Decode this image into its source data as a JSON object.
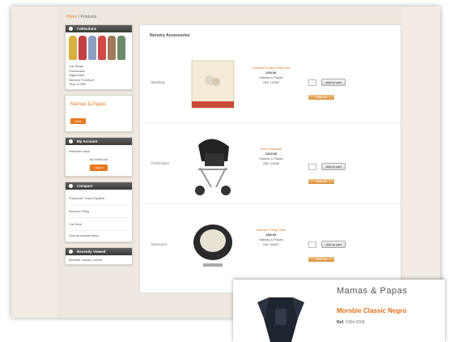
{
  "breadcrumb": {
    "home": "Home",
    "current": "Products"
  },
  "sidebar": {
    "collections": {
      "title": "Collections",
      "links": [
        "Car Seats",
        "Pushchairs",
        "Highchairs",
        "Nursery Furniture",
        "Toys & Gifts"
      ]
    },
    "promo": {
      "title": "Mamas & Papas",
      "button": "View"
    },
    "account": {
      "title": "My Account",
      "label": "Welcome back",
      "value": "My Wish List",
      "button": "Log In"
    },
    "compare": {
      "title": "Compare",
      "items": [
        "Pushchair Travel System",
        "Bouncer Sling",
        "Car Seat"
      ],
      "footer": "Clear all compare items"
    },
    "recent": {
      "title": "Recently Viewed",
      "items": [
        "Morsbie Classic Carrier"
      ]
    }
  },
  "main": {
    "title": "Nursery Accessories",
    "products": [
      {
        "category": "Bedding",
        "name": "Cotbed/Cot Bed Sheet Set",
        "price": "£29.00",
        "brand": "Mamas & Papas",
        "sku": "Ref: 12345",
        "add_label": "Add to cart",
        "wish_label": "Wish list",
        "qty": "1"
      },
      {
        "category": "Pushchairs",
        "name": "Sola Pushchair",
        "price": "£319.00",
        "brand": "Mamas & Papas",
        "sku": "Ref: 23456",
        "add_label": "Add to cart",
        "wish_label": "Wish list",
        "qty": "1"
      },
      {
        "category": "Bouncers",
        "name": "Bouncer Sling Chair",
        "price": "£89.00",
        "brand": "Mamas & Papas",
        "sku": "Ref: 34567",
        "add_label": "Add to cart",
        "wish_label": "Wish list",
        "qty": "1"
      }
    ]
  },
  "popup": {
    "brand": "Mamas & Papas",
    "product": "Morsbie Classic Negro",
    "sku_label": "Ref.",
    "sku": "5354 0008"
  },
  "colors": {
    "accent": "#e8781c",
    "header": "#3a3a3a"
  }
}
